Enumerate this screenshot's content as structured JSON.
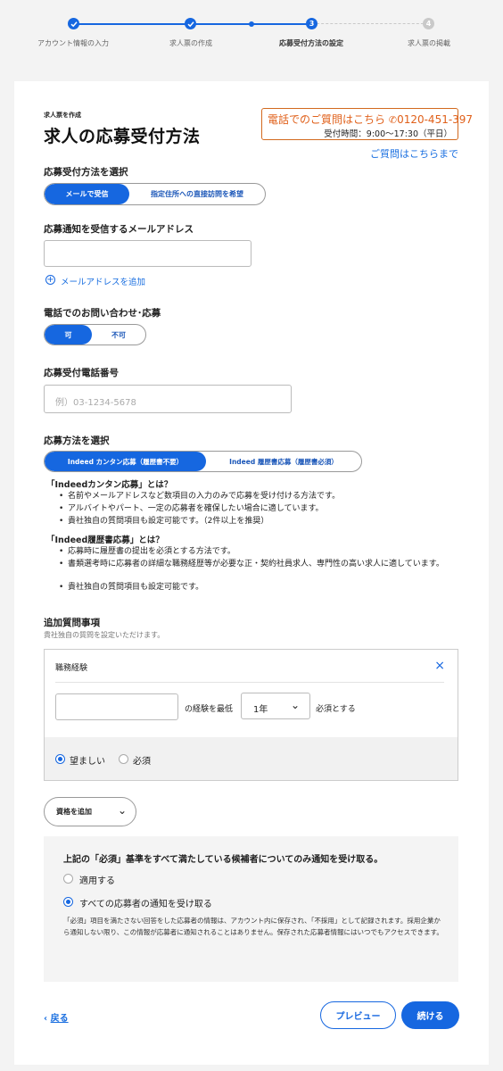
{
  "stepper": {
    "steps": [
      {
        "label": "アカウント情報の入力",
        "state": "done",
        "number": ""
      },
      {
        "label": "求人票の作成",
        "state": "done",
        "number": ""
      },
      {
        "label": "応募受付方法の設定",
        "state": "current",
        "number": "3"
      },
      {
        "label": "求人票の掲載",
        "state": "todo",
        "number": "4"
      }
    ]
  },
  "header": {
    "eyebrow": "求人票を作成",
    "title": "求人の応募受付方法",
    "phone_prompt": "電話でのご質問はこちら",
    "phone_number": "0120-451-397",
    "hours": "受付時間：9:00〜17:30（平日）",
    "faq_link": "ご質問はこちらまで"
  },
  "apply_method": {
    "label": "応募受付方法を選択",
    "options": [
      "メールで受信",
      "指定住所への直接訪問を希望"
    ],
    "selected": 0
  },
  "email": {
    "label": "応募通知を受信するメールアドレス",
    "value": "",
    "placeholder": "",
    "add_link": "メールアドレスを追加"
  },
  "phone_inquiry": {
    "label": "電話でのお問い合わせ･応募",
    "options": [
      "可",
      "不可"
    ],
    "selected": 0
  },
  "phone_number_field": {
    "label": "応募受付電話番号",
    "value": "",
    "placeholder": "例）03-1234-5678"
  },
  "application_type": {
    "label": "応募方法を選択",
    "options": [
      "Indeed カンタン応募（履歴書不要）",
      "Indeed 履歴書応募（履歴書必須）"
    ],
    "selected": 0,
    "easy_heading": "「Indeedカンタン応募」とは？",
    "easy_points": [
      "名前やメールアドレスなど数項目の入力のみで応募を受け付ける方法です。",
      "アルバイトやパート、一定の応募者を確保したい場合に適しています。",
      "貴社独自の質問項目も設定可能です。（2件以上を推奨）"
    ],
    "resume_heading": "「Indeed履歴書応募」とは？",
    "resume_points": [
      "応募時に履歴書の提出を必須とする方法です。",
      "書類選考時に応募者の詳細な職務経歴等が必要な正・契約社員求人、専門性の高い求人に適しています。",
      "貴社独自の質問項目も設定可能です。"
    ]
  },
  "questions": {
    "label": "追加質問事項",
    "sublabel": "貴社独自の質問を設定いただけます。",
    "card_title": "職務経験",
    "experience_value": "",
    "experience_suffix": "の経験を最低",
    "years_selected": "1年",
    "required_suffix": "必須とする",
    "priority_options": [
      "望ましい",
      "必須"
    ],
    "priority_selected": 0,
    "add_button": "資格を追加"
  },
  "notification": {
    "heading": "上記の「必須」基準をすべて満たしている候補者についてのみ通知を受け取る。",
    "options": [
      "適用する",
      "すべての応募者の通知を受け取る"
    ],
    "selected": 1,
    "note": "「必須」項目を満たさない回答をした応募者の情報は、アカウント内に保存され、「不採用」として記録されます。採用企業から通知しない限り、この情報が応募者に通知されることはありません。保存された応募者情報にはいつでもアクセスできます。"
  },
  "footer": {
    "back": "戻る",
    "preview": "プレビュー",
    "continue": "続ける"
  },
  "colors": {
    "primary": "#1667e0",
    "phone_accent": "#e0601a",
    "link": "#1a6fe0"
  }
}
